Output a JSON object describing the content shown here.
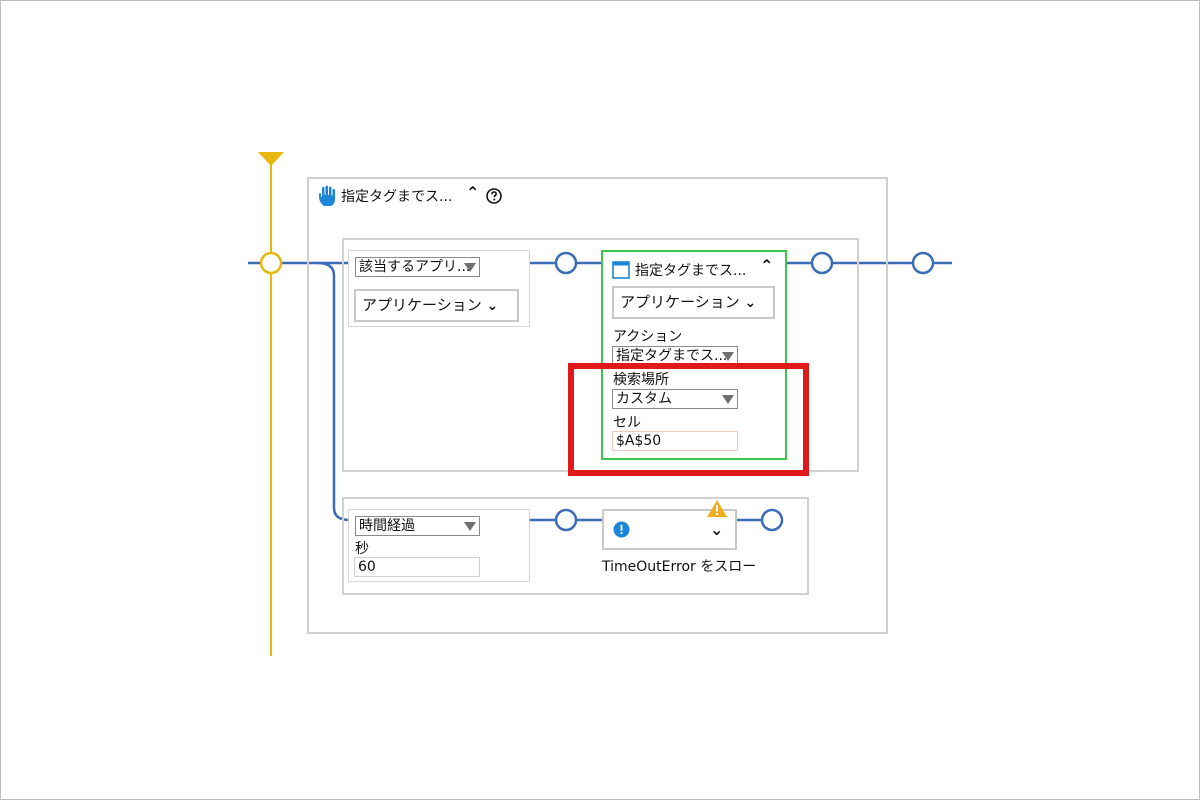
{
  "outer_block": {
    "title": "指定タグまでス...",
    "collapse_icon": "chevron-up-icon",
    "help_icon": "help-circle-icon"
  },
  "branch_app": {
    "selector": "該当するアプリ...",
    "dropdown": "アプリケーション"
  },
  "action_card": {
    "title": "指定タグまでス...",
    "app_dropdown": "アプリケーション",
    "action_label": "アクション",
    "action_value": "指定タグまでス...",
    "search_label": "検索場所",
    "search_value": "カスタム",
    "cell_label": "セル",
    "cell_value": "$A$50"
  },
  "branch_time": {
    "selector": "時間経過",
    "seconds_label": "秒",
    "seconds_value": "60"
  },
  "error_card": {
    "caption": "TimeOutError をスロー"
  },
  "colors": {
    "flow_line": "#3a6db5",
    "timeline": "#e8b810",
    "highlight": "#e01a1a",
    "selected": "#3cc44c"
  }
}
